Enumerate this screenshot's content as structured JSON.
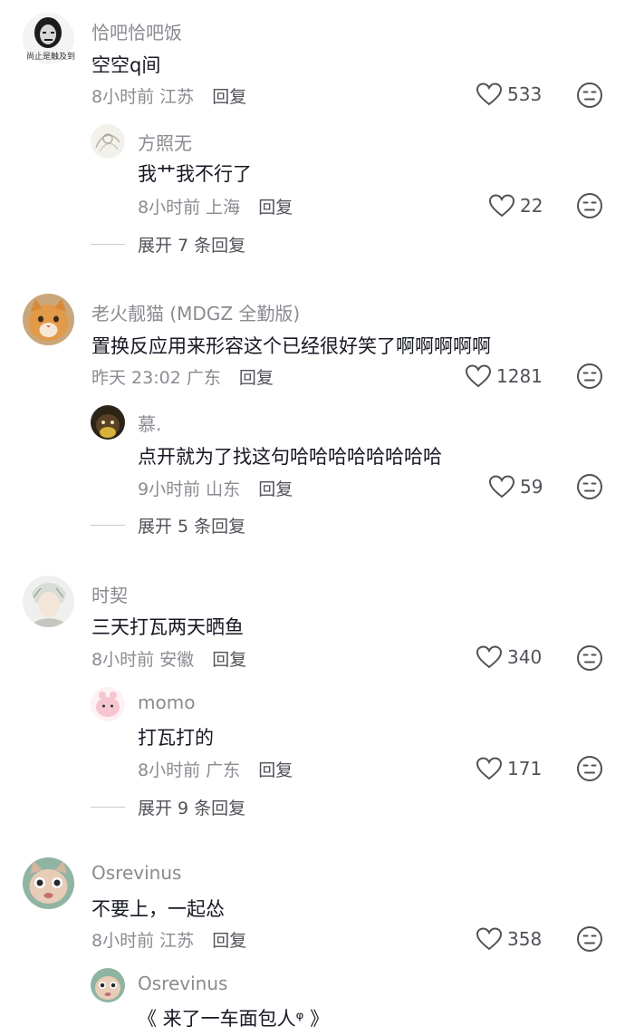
{
  "colors": {
    "text": "#161823",
    "meta": "#8a8b91",
    "action": "#505258"
  },
  "comments": [
    {
      "user": "恰吧恰吧饭",
      "avatar_icon": "meme-face-avatar",
      "avatar_caption": "尚止是触及到",
      "text": "空空q间",
      "time": "8小时前",
      "location": "江苏",
      "reply": "回复",
      "likes": "533",
      "replies": [
        {
          "user": "方照无",
          "avatar_icon": "sketch-avatar",
          "text": "我艹我不行了",
          "time": "8小时前",
          "location": "上海",
          "reply": "回复",
          "likes": "22"
        }
      ],
      "expand": "展开 7 条回复"
    },
    {
      "user": "老火靓猫 (MDGZ 全勤版)",
      "avatar_icon": "orange-cat-avatar",
      "text": "置换反应用来形容这个已经很好笑了啊啊啊啊啊",
      "time": "昨天 23:02",
      "location": "广东",
      "reply": "回复",
      "likes": "1281",
      "replies": [
        {
          "user": "慕.",
          "avatar_icon": "dark-creature-avatar",
          "text": "点开就为了找这句哈哈哈哈哈哈哈哈",
          "time": "9小时前",
          "location": "山东",
          "reply": "回复",
          "likes": "59"
        }
      ],
      "expand": "展开 5 条回复"
    },
    {
      "user": "时契",
      "avatar_icon": "anime-character-avatar",
      "text": "三天打瓦两天晒鱼",
      "time": "8小时前",
      "location": "安徽",
      "reply": "回复",
      "likes": "340",
      "replies": [
        {
          "user": "momo",
          "avatar_icon": "pink-blob-avatar",
          "text": "打瓦打的",
          "time": "8小时前",
          "location": "广东",
          "reply": "回复",
          "likes": "171"
        }
      ],
      "expand": "展开 9 条回复"
    },
    {
      "user": "Osrevinus",
      "avatar_icon": "cartoon-cat-avatar",
      "text": "不要上，一起怂",
      "time": "8小时前",
      "location": "江苏",
      "reply": "回复",
      "likes": "358",
      "replies": [
        {
          "user": "Osrevinus",
          "avatar_icon": "cartoon-cat-avatar",
          "text": "《 来了一车面包人ᵠ 》"
        }
      ]
    }
  ]
}
